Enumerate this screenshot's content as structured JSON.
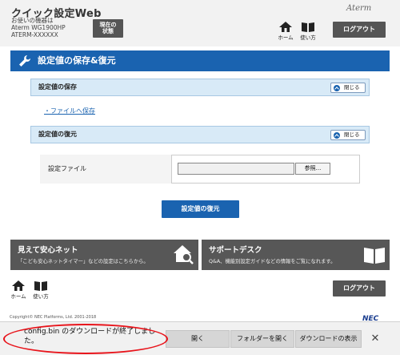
{
  "header": {
    "app_title": "クイック設定Web",
    "device_label": "お使いの機器は",
    "device_model": "Aterm WG1900HP",
    "device_id": "ATERM-XXXXXX",
    "now_status_line1": "現在の",
    "now_status_line2": "状態",
    "home_label": "ホーム",
    "howto_label": "使い方",
    "brand": "Aterm",
    "logout_label": "ログアウト"
  },
  "page": {
    "title": "設定値の保存&復元",
    "icon": "wrench-icon",
    "accent_color": "#1a63b0"
  },
  "save_section": {
    "title": "設定値の保存",
    "close_label": "閉じる",
    "link_label": "ファイルへ保存"
  },
  "restore_section": {
    "title": "設定値の復元",
    "close_label": "閉じる",
    "file_label": "設定ファイル",
    "file_value": "",
    "browse_label": "参照...",
    "restore_button": "設定値の復元"
  },
  "banners": [
    {
      "title": "見えて安心ネット",
      "subtitle": "「こども安心ネットタイマー」などの設定はこちらから。",
      "icon": "house-search-icon"
    },
    {
      "title": "サポートデスク",
      "subtitle": "Q&A、機能別設定ガイドなどの情報をご覧になれます。",
      "icon": "book-icon"
    }
  ],
  "footer": {
    "home_label": "ホーム",
    "howto_label": "使い方",
    "logout_label": "ログアウト",
    "copyright": "Copyright© NEC Platforms, Ltd. 2001-2018",
    "nec_logo": "NEC"
  },
  "download_bar": {
    "message": "config.bin のダウンロードが終了しました。",
    "open_label": "開く",
    "open_folder_label": "フォルダーを開く",
    "show_downloads_label": "ダウンロードの表示",
    "close_symbol": "✕",
    "highlight_color": "#e8141b"
  }
}
